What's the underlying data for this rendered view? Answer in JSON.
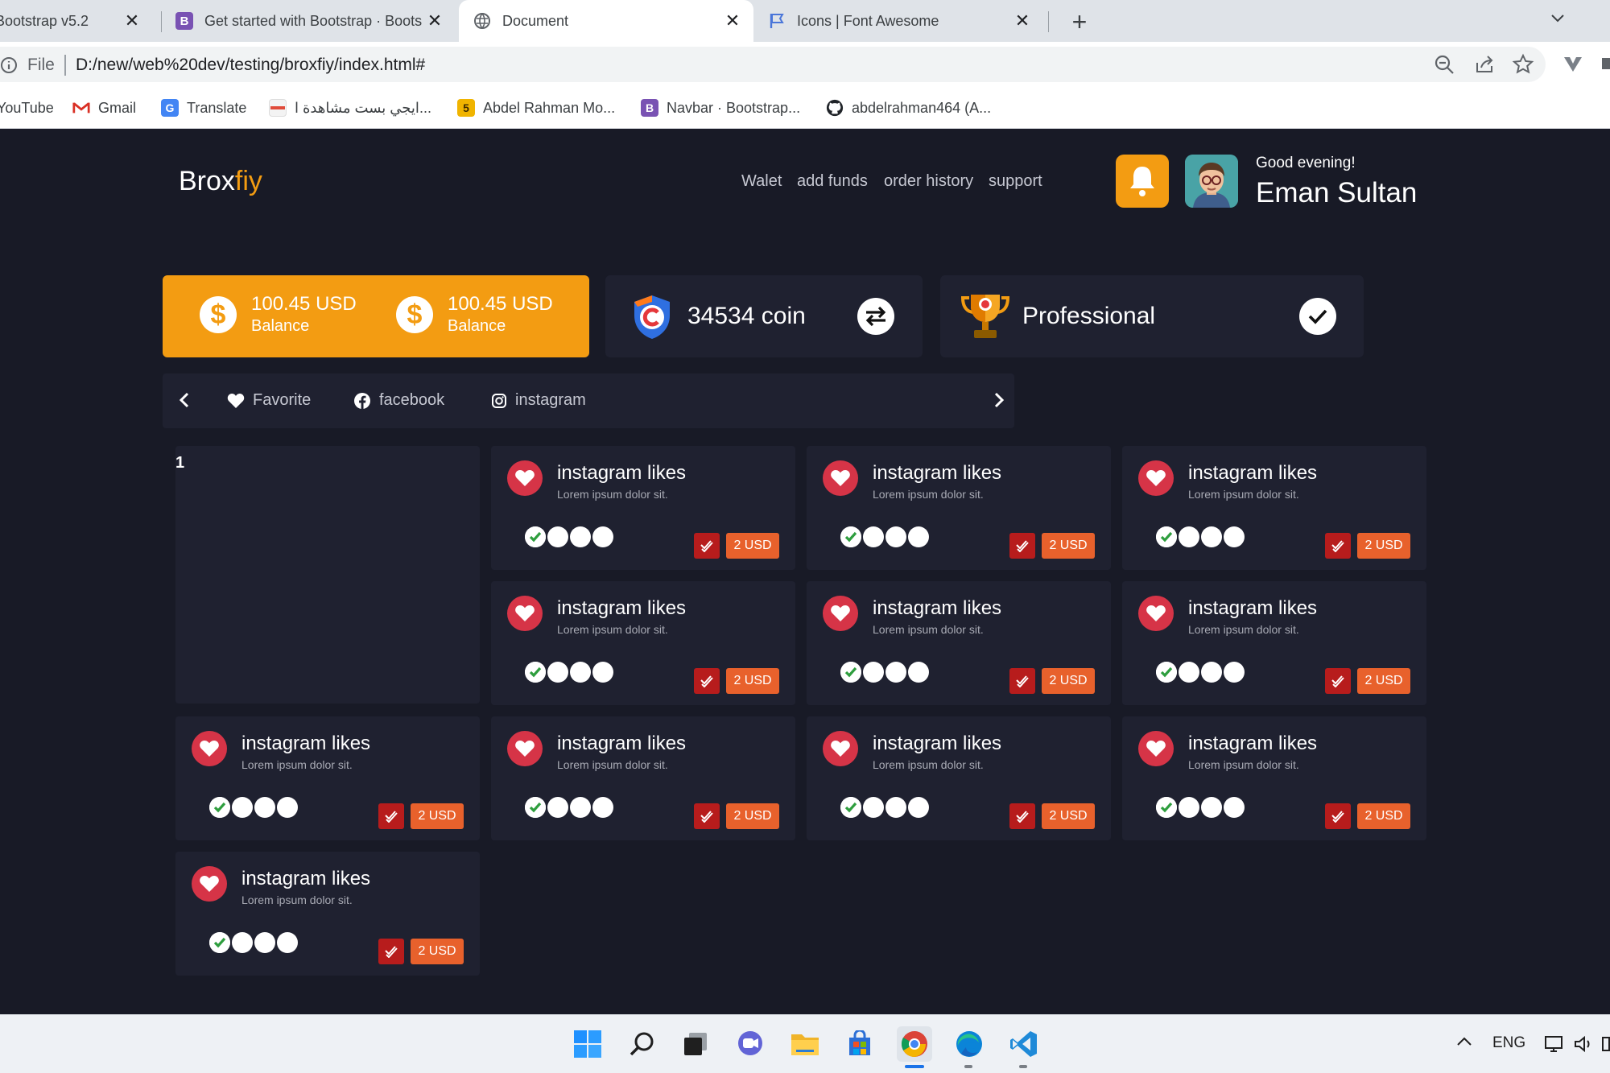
{
  "browser": {
    "tabs": [
      {
        "title": "Bootstrap v5.2",
        "favicon": "bootstrap-icon"
      },
      {
        "title": "Get started with Bootstrap · Bootstrap",
        "favicon": "bootstrap-icon"
      },
      {
        "title": "Document",
        "favicon": "globe-icon"
      },
      {
        "title": "Icons | Font Awesome",
        "favicon": "flag-icon"
      }
    ],
    "close_glyph": "✕",
    "new_tab_glyph": "+",
    "address": {
      "scheme_label": "File",
      "url": "D:/new/web%20dev/testing/broxfiy/index.html#"
    },
    "bookmarks": [
      {
        "label": "YouTube",
        "icon": "youtube-icon"
      },
      {
        "label": "Gmail",
        "icon": "gmail-icon"
      },
      {
        "label": "Translate",
        "icon": "translate-icon"
      },
      {
        "label": "ايجي بست مشاهدة ا...",
        "icon": "egybest-icon"
      },
      {
        "label": "Abdel Rahman Mo...",
        "icon": "five-icon",
        "icon_text": "5"
      },
      {
        "label": "Navbar · Bootstrap...",
        "icon": "bootstrap-icon",
        "icon_text": "B"
      },
      {
        "label": "abdelrahman464 (A...",
        "icon": "github-icon"
      }
    ]
  },
  "site": {
    "brand_main": "Brox",
    "brand_accent": "fiy",
    "nav": [
      "Walet",
      "add funds",
      "order history",
      "support"
    ],
    "greeting": "Good evening!",
    "user_name": "Eman Sultan",
    "balances": [
      {
        "amount": "100.45 USD",
        "label": "Balance"
      },
      {
        "amount": "100.45 USD",
        "label": "Balance"
      }
    ],
    "coins": "34534 coin",
    "level": "Professional",
    "filters": [
      "Favorite",
      "facebook",
      "instagram"
    ],
    "sidebox_number": "1",
    "cards": [
      {
        "title": "instagram likes",
        "subtitle": "Lorem ipsum dolor sit.",
        "price": "2 USD"
      },
      {
        "title": "instagram likes",
        "subtitle": "Lorem ipsum dolor sit.",
        "price": "2 USD"
      },
      {
        "title": "instagram likes",
        "subtitle": "Lorem ipsum dolor sit.",
        "price": "2 USD"
      },
      {
        "title": "instagram likes",
        "subtitle": "Lorem ipsum dolor sit.",
        "price": "2 USD"
      },
      {
        "title": "instagram likes",
        "subtitle": "Lorem ipsum dolor sit.",
        "price": "2 USD"
      },
      {
        "title": "instagram likes",
        "subtitle": "Lorem ipsum dolor sit.",
        "price": "2 USD"
      },
      {
        "title": "instagram likes",
        "subtitle": "Lorem ipsum dolor sit.",
        "price": "2 USD"
      },
      {
        "title": "instagram likes",
        "subtitle": "Lorem ipsum dolor sit.",
        "price": "2 USD"
      },
      {
        "title": "instagram likes",
        "subtitle": "Lorem ipsum dolor sit.",
        "price": "2 USD"
      },
      {
        "title": "instagram likes",
        "subtitle": "Lorem ipsum dolor sit.",
        "price": "2 USD"
      },
      {
        "title": "instagram likes",
        "subtitle": "Lorem ipsum dolor sit.",
        "price": "2 USD"
      }
    ]
  },
  "taskbar": {
    "apps": [
      "start-icon",
      "search-icon",
      "task-view-icon",
      "chat-icon",
      "file-explorer-icon",
      "store-icon",
      "chrome-icon",
      "edge-icon",
      "vscode-icon"
    ],
    "language": "ENG"
  },
  "colors": {
    "page_bg": "#181a26",
    "card_bg": "#1f2130",
    "accent": "#f39c12",
    "heart": "#d63447",
    "check": "#b71c1c",
    "price": "#e8612c"
  }
}
